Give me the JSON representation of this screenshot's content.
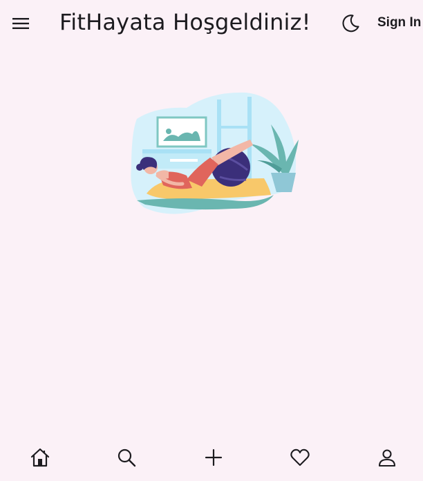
{
  "header": {
    "menu_icon": "menu-icon",
    "title": "FitHayata Hoşgeldiniz!",
    "theme_icon": "moon-icon",
    "sign_in_label": "Sign In"
  },
  "hero": {
    "image": "woman-exercising-with-ball-illustration"
  },
  "bottom_nav": {
    "items": [
      {
        "icon": "home-icon"
      },
      {
        "icon": "search-icon"
      },
      {
        "icon": "plus-icon"
      },
      {
        "icon": "heart-icon"
      },
      {
        "icon": "person-icon"
      }
    ]
  },
  "colors": {
    "background": "#fbf1f7",
    "text": "#1c1b1f",
    "illustration_sky": "#d6f1fb",
    "illustration_mat": "#f8c86a",
    "illustration_ball": "#3b2f7a"
  }
}
